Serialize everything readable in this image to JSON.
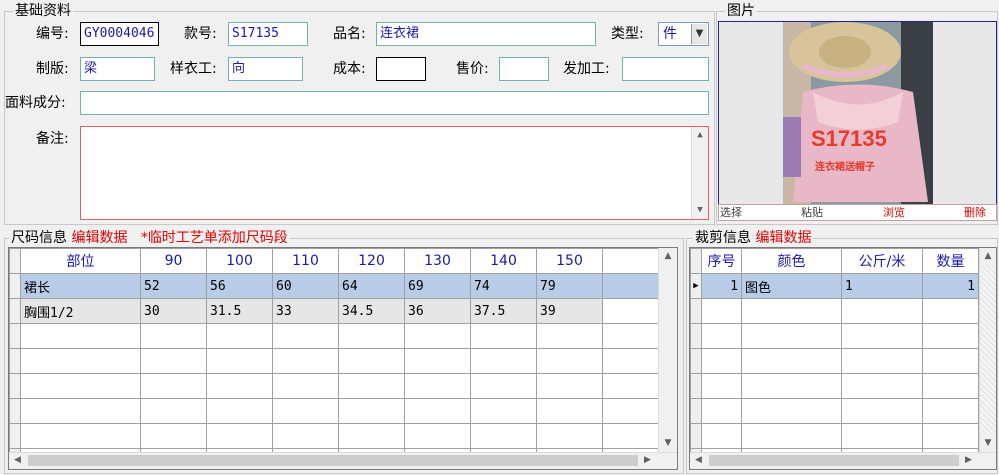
{
  "basic": {
    "title": "基础资料",
    "code_label": "编号:",
    "code_value": "GY0004046",
    "style_label": "款号:",
    "style_value": "S17135",
    "name_label": "品名:",
    "name_value": "连衣裙",
    "type_label": "类型:",
    "type_value": "件",
    "pattern_label": "制版:",
    "pattern_value": "梁",
    "sample_label": "样衣工:",
    "sample_value": "向",
    "cost_label": "成本:",
    "cost_value": "",
    "price_label": "售价:",
    "price_value": "",
    "process_label": "发加工:",
    "process_value": "",
    "fabric_label": "面料成分:",
    "fabric_value": "",
    "remark_label": "备注:",
    "remark_value": ""
  },
  "image_panel": {
    "title": "图片",
    "overlay_code": "S17135",
    "overlay_text": "连衣裙送帽子",
    "buttons": [
      "选择",
      "粘贴",
      "浏览",
      "删除"
    ]
  },
  "size_panel": {
    "title": "尺码信息",
    "edit_link": "编辑数据",
    "temp_link": "*临时工艺单添加尺码段",
    "columns": [
      "部位",
      "90",
      "100",
      "110",
      "120",
      "130",
      "140",
      "150"
    ],
    "rows": [
      [
        "裙长",
        "52",
        "56",
        "60",
        "64",
        "69",
        "74",
        "79"
      ],
      [
        "胸围1/2",
        "30",
        "31.5",
        "33",
        "34.5",
        "36",
        "37.5",
        "39"
      ]
    ]
  },
  "cut_panel": {
    "title": "裁剪信息",
    "edit_link": "编辑数据",
    "columns": [
      "序号",
      "颜色",
      "公斤/米",
      "数量"
    ],
    "rows": [
      [
        "1",
        "图色",
        "1",
        "1"
      ]
    ]
  },
  "colors": {
    "accent_red": "#e00000",
    "header_blue": "#1a1aa8",
    "selection": "#b8cce8"
  }
}
